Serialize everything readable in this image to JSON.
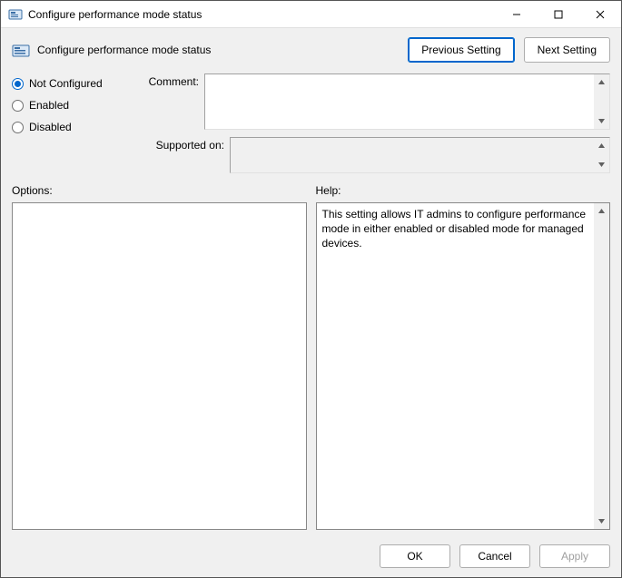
{
  "window": {
    "title": "Configure performance mode status",
    "minimize_tooltip": "Minimize",
    "maximize_tooltip": "Maximize",
    "close_tooltip": "Close"
  },
  "policy": {
    "name": "Configure performance mode status"
  },
  "nav": {
    "previous_label": "Previous Setting",
    "next_label": "Next Setting"
  },
  "state": {
    "options": [
      {
        "label": "Not Configured",
        "checked": true
      },
      {
        "label": "Enabled",
        "checked": false
      },
      {
        "label": "Disabled",
        "checked": false
      }
    ]
  },
  "fields": {
    "comment_label": "Comment:",
    "comment_value": "",
    "supported_label": "Supported on:",
    "supported_value": ""
  },
  "sections": {
    "options_label": "Options:",
    "help_label": "Help:"
  },
  "help": {
    "text": "This setting allows IT admins to configure performance mode in either enabled or disabled mode for managed devices."
  },
  "footer": {
    "ok_label": "OK",
    "cancel_label": "Cancel",
    "apply_label": "Apply",
    "apply_enabled": false
  }
}
